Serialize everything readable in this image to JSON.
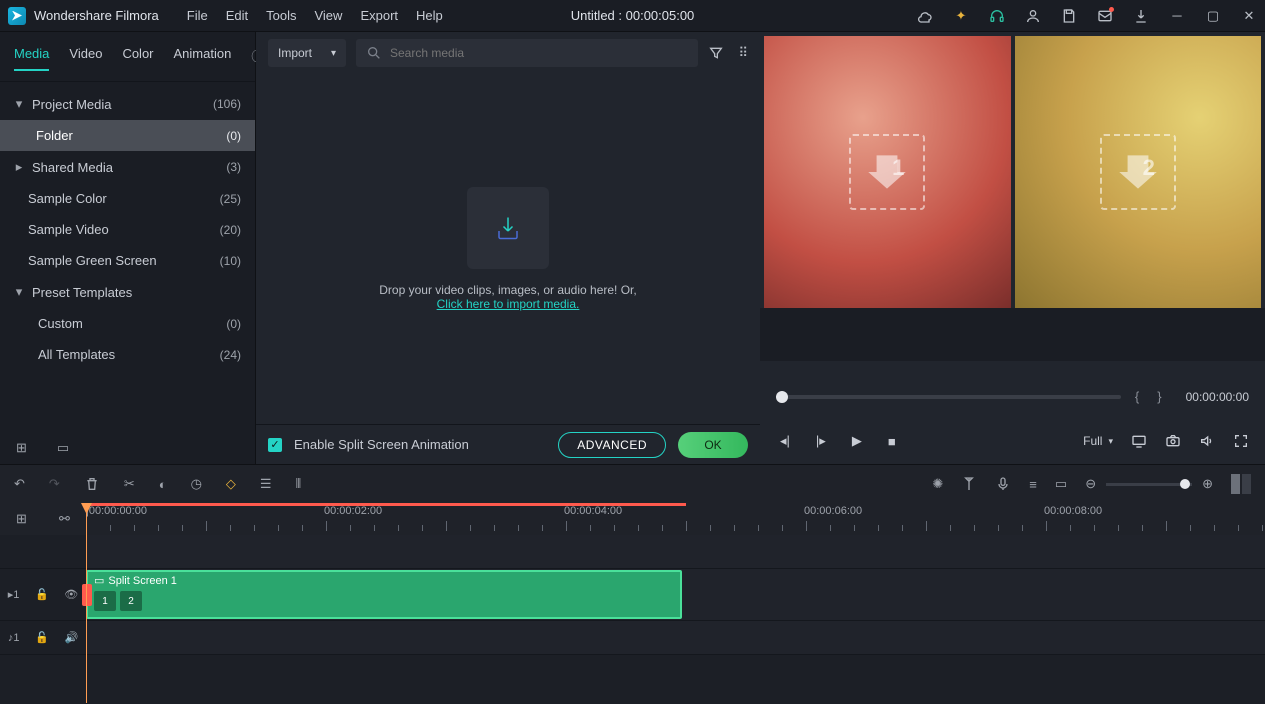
{
  "app": {
    "name": "Wondershare Filmora"
  },
  "menu": [
    "File",
    "Edit",
    "Tools",
    "View",
    "Export",
    "Help"
  ],
  "project_title": "Untitled : 00:00:05:00",
  "tabs": [
    "Media",
    "Video",
    "Color",
    "Animation"
  ],
  "tree": {
    "project_media": {
      "label": "Project Media",
      "count": "(106)"
    },
    "folder": {
      "label": "Folder",
      "count": "(0)"
    },
    "shared_media": {
      "label": "Shared Media",
      "count": "(3)"
    },
    "sample_color": {
      "label": "Sample Color",
      "count": "(25)"
    },
    "sample_video": {
      "label": "Sample Video",
      "count": "(20)"
    },
    "sample_green": {
      "label": "Sample Green Screen",
      "count": "(10)"
    },
    "preset_templates": {
      "label": "Preset Templates"
    },
    "custom": {
      "label": "Custom",
      "count": "(0)"
    },
    "all_templates": {
      "label": "All Templates",
      "count": "(24)"
    }
  },
  "import_btn": "Import",
  "search_placeholder": "Search media",
  "drop_text": "Drop your video clips, images, or audio here! Or,",
  "drop_link": "Click here to import media.",
  "split_chk": "Enable Split Screen Animation",
  "btn_adv": "ADVANCED",
  "btn_ok": "OK",
  "preview": {
    "slot1": "1",
    "slot2": "2",
    "time": "00:00:00:00",
    "quality": "Full"
  },
  "ruler": {
    "t0": "|00:00:00:00",
    "t2": "00:00:02:00",
    "t4": "00:00:04:00",
    "t6": "00:00:06:00",
    "t8": "00:00:08:00"
  },
  "tracks": {
    "video1": "▸1",
    "audio1": "♪1"
  },
  "clip": {
    "name": "Split Screen 1",
    "seg1": "1",
    "seg2": "2"
  }
}
